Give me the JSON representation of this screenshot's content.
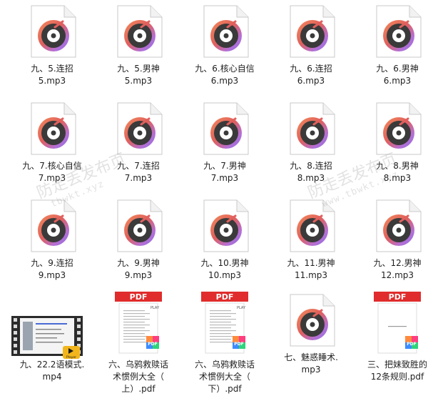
{
  "files": [
    {
      "name": "九、5.连招\n5.mp3",
      "type": "audio"
    },
    {
      "name": "九、5.男神\n5.mp3",
      "type": "audio"
    },
    {
      "name": "九、6.核心自信\n6.mp3",
      "type": "audio"
    },
    {
      "name": "九、6.连招\n6.mp3",
      "type": "audio"
    },
    {
      "name": "九、6.男神\n6.mp3",
      "type": "audio"
    },
    {
      "name": "九、7.核心自信\n7.mp3",
      "type": "audio"
    },
    {
      "name": "九、7.连招\n7.mp3",
      "type": "audio"
    },
    {
      "name": "九、7.男神\n7.mp3",
      "type": "audio"
    },
    {
      "name": "九、8.连招\n8.mp3",
      "type": "audio"
    },
    {
      "name": "九、8.男神\n8.mp3",
      "type": "audio"
    },
    {
      "name": "九、9.连招\n9.mp3",
      "type": "audio"
    },
    {
      "name": "九、9.男神\n9.mp3",
      "type": "audio"
    },
    {
      "name": "九、10.男神\n10.mp3",
      "type": "audio"
    },
    {
      "name": "九、11.男神\n11.mp3",
      "type": "audio"
    },
    {
      "name": "九、12.男神\n12.mp3",
      "type": "audio"
    },
    {
      "name": "九、22.2语模式.\nmp4",
      "type": "video",
      "badge": "Player"
    },
    {
      "name": "六、乌鸦救赎话\n术惯例大全（\n上）.pdf",
      "type": "pdf",
      "badge": "PDF",
      "thumb_label": "PLAY"
    },
    {
      "name": "六、乌鸦救赎话\n术惯例大全（\n下）.pdf",
      "type": "pdf",
      "badge": "PDF",
      "thumb_label": "PLAY"
    },
    {
      "name": "七、魅惑睡术.\nmp3",
      "type": "audio"
    },
    {
      "name": "三、把妹致胜的\n12条规则.pdf",
      "type": "pdf",
      "badge": "PDF",
      "thumb_label": ""
    }
  ],
  "watermarks": [
    {
      "text": "防走丢发布页",
      "sub": "tbwkt.xyz"
    },
    {
      "text": "防走丢发布页",
      "sub": "www.tbwkt.xyz"
    }
  ],
  "colors": {
    "disc_dark": "#3a3a3a",
    "ring_gradient": [
      "#f28a5a",
      "#e0605d",
      "#b46fd6",
      "#8a6ee0"
    ],
    "pdf_red": "#e02c2c",
    "pdf_badge": [
      "#ff8a3d",
      "#ff3d7f",
      "#3d8bff",
      "#2ed47a"
    ]
  }
}
